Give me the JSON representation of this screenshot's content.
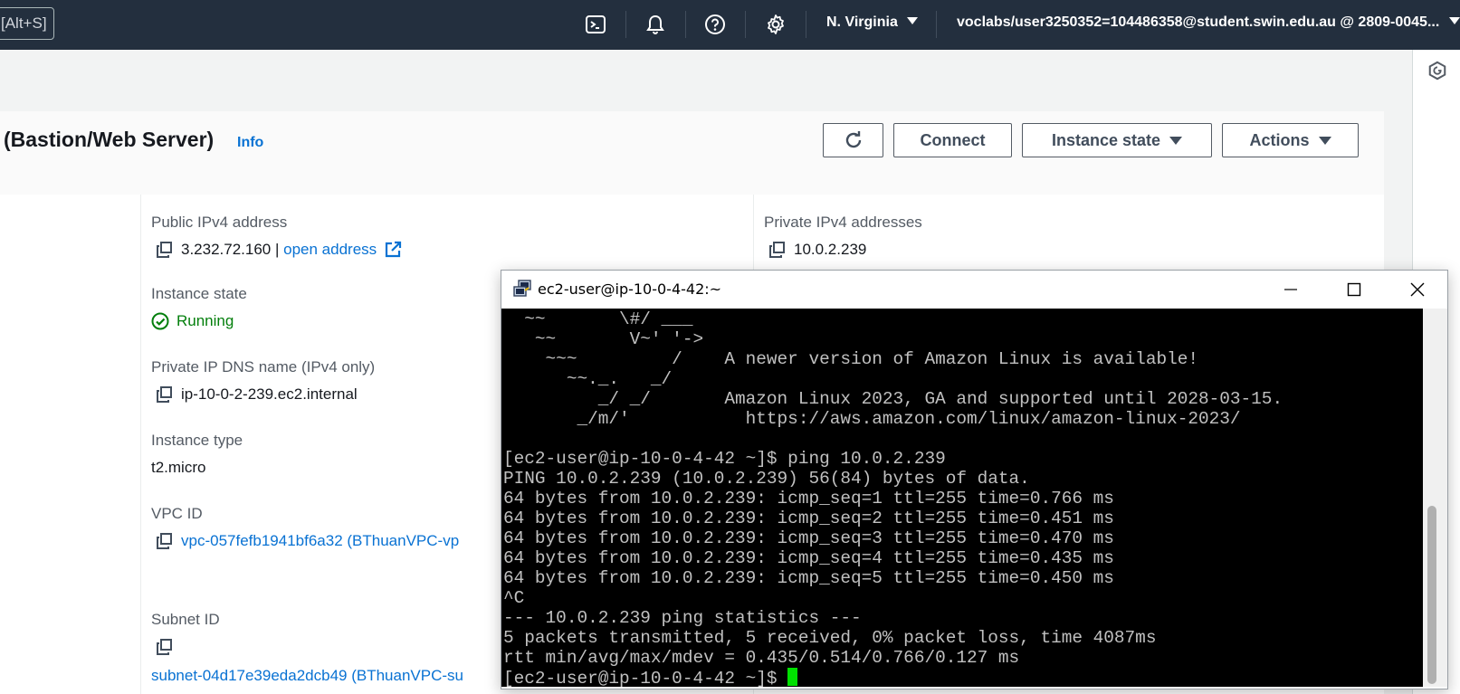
{
  "topbar": {
    "shortcut_hint": "[Alt+S]",
    "region": "N. Virginia",
    "account": "voclabs/user3250352=104486358@student.swin.edu.au @ 2809-0045..."
  },
  "header": {
    "title": "(Bastion/Web Server)",
    "info": "Info",
    "connect": "Connect",
    "instance_state": "Instance state",
    "actions": "Actions"
  },
  "details": {
    "public_ipv4_label": "Public IPv4 address",
    "public_ipv4_value": "3.232.72.160",
    "public_ipv4_sep": " | ",
    "open_address": "open address",
    "private_ipv4_label": "Private IPv4 addresses",
    "private_ipv4_value": "10.0.2.239",
    "instance_state_label": "Instance state",
    "instance_state_value": "Running",
    "private_dns_label": "Private IP DNS name (IPv4 only)",
    "private_dns_value": "ip-10-0-2-239.ec2.internal",
    "instance_type_label": "Instance type",
    "instance_type_value": "t2.micro",
    "vpc_label": "VPC ID",
    "vpc_value": "vpc-057fefb1941bf6a32 (BThuanVPC-vp",
    "subnet_label": "Subnet ID",
    "subnet_value": "subnet-04d17e39eda2dcb49 (BThuanVPC-su"
  },
  "terminal": {
    "title": "ec2-user@ip-10-0-4-42:~",
    "lines": [
      "  ~~       \\#/ ___",
      "   ~~       V~' '->",
      "    ~~~         /    A newer version of Amazon Linux is available!",
      "      ~~._.   _/",
      "         _/ _/       Amazon Linux 2023, GA and supported until 2028-03-15.",
      "       _/m/'           https://aws.amazon.com/linux/amazon-linux-2023/",
      "",
      "[ec2-user@ip-10-0-4-42 ~]$ ping 10.0.2.239",
      "PING 10.0.2.239 (10.0.2.239) 56(84) bytes of data.",
      "64 bytes from 10.0.2.239: icmp_seq=1 ttl=255 time=0.766 ms",
      "64 bytes from 10.0.2.239: icmp_seq=2 ttl=255 time=0.451 ms",
      "64 bytes from 10.0.2.239: icmp_seq=3 ttl=255 time=0.470 ms",
      "64 bytes from 10.0.2.239: icmp_seq=4 ttl=255 time=0.435 ms",
      "64 bytes from 10.0.2.239: icmp_seq=5 ttl=255 time=0.450 ms",
      "^C",
      "--- 10.0.2.239 ping statistics ---",
      "5 packets transmitted, 5 received, 0% packet loss, time 4087ms",
      "rtt min/avg/max/mdev = 0.435/0.514/0.766/0.127 ms"
    ],
    "prompt": "[ec2-user@ip-10-0-4-42 ~]$ "
  },
  "icons": {
    "cloudshell": "terminal-icon",
    "notifications": "bell-icon",
    "help": "help-icon",
    "settings": "gear-icon"
  },
  "colors": {
    "nav_bg": "#232f3e",
    "link": "#0972d3",
    "running": "#037f0c",
    "cursor": "#00e000"
  }
}
